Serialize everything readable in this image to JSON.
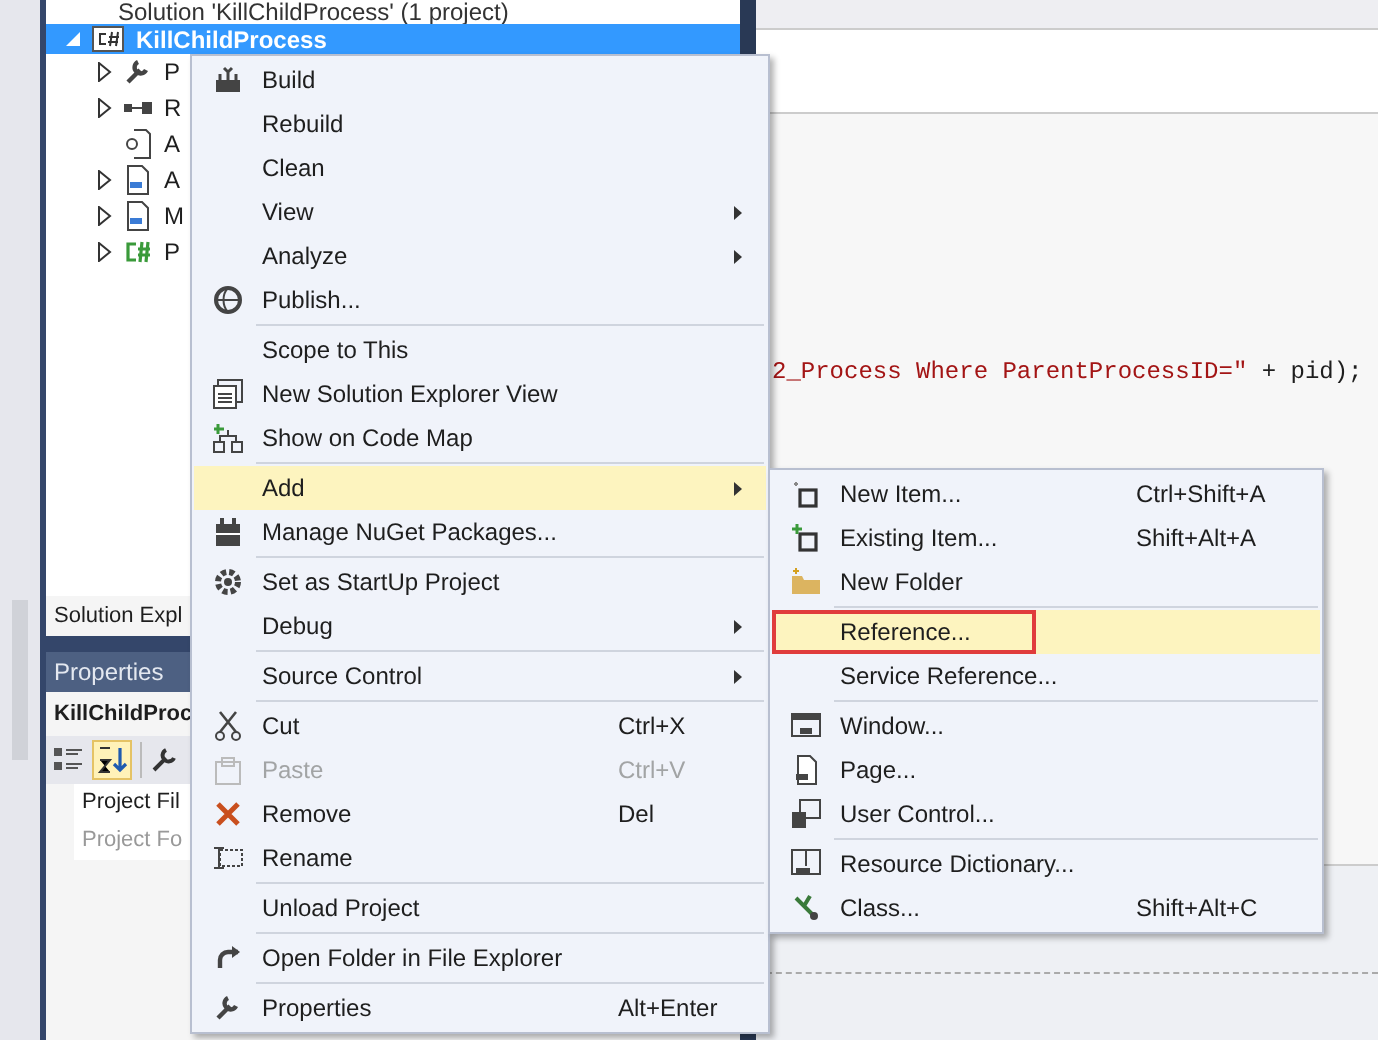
{
  "solution_explorer": {
    "solution_row": "Solution 'KillChildProcess' (1 project)",
    "project_row": {
      "label": "KillChildProcess",
      "selected": true
    },
    "children": [
      {
        "label": "P",
        "expandable": true
      },
      {
        "label": "R",
        "expandable": true
      },
      {
        "label": "A",
        "expandable": false
      },
      {
        "label": "A",
        "expandable": true
      },
      {
        "label": "M",
        "expandable": true
      },
      {
        "label": "P",
        "expandable": true
      }
    ],
    "tab": "Solution Expl"
  },
  "properties": {
    "title": "Properties",
    "object": "KillChildProc",
    "rows": [
      {
        "label": "Project Fil",
        "disabled": false
      },
      {
        "label": "Project Fo",
        "disabled": true
      }
    ]
  },
  "editor": {
    "code_string": "2_Process Where ParentProcessID=\"",
    "code_rest": " + pid);"
  },
  "context_menu": [
    {
      "kind": "item",
      "label": "Build",
      "submenu": false,
      "disabled": false,
      "selected": false
    },
    {
      "kind": "item",
      "label": "Rebuild",
      "submenu": false,
      "disabled": false,
      "selected": false
    },
    {
      "kind": "item",
      "label": "Clean",
      "submenu": false,
      "disabled": false,
      "selected": false
    },
    {
      "kind": "item",
      "label": "View",
      "submenu": true,
      "disabled": false,
      "selected": false
    },
    {
      "kind": "item",
      "label": "Analyze",
      "submenu": true,
      "disabled": false,
      "selected": false
    },
    {
      "kind": "item",
      "label": "Publish...",
      "submenu": false,
      "disabled": false,
      "selected": false
    },
    {
      "kind": "separator"
    },
    {
      "kind": "item",
      "label": "Scope to This",
      "submenu": false,
      "disabled": false,
      "selected": false
    },
    {
      "kind": "item",
      "label": "New Solution Explorer View",
      "submenu": false,
      "disabled": false,
      "selected": false
    },
    {
      "kind": "item",
      "label": "Show on Code Map",
      "submenu": false,
      "disabled": false,
      "selected": false
    },
    {
      "kind": "separator"
    },
    {
      "kind": "item",
      "label": "Add",
      "submenu": true,
      "disabled": false,
      "selected": true
    },
    {
      "kind": "item",
      "label": "Manage NuGet Packages...",
      "submenu": false,
      "disabled": false,
      "selected": false
    },
    {
      "kind": "separator"
    },
    {
      "kind": "item",
      "label": "Set as StartUp Project",
      "submenu": false,
      "disabled": false,
      "selected": false
    },
    {
      "kind": "item",
      "label": "Debug",
      "submenu": true,
      "disabled": false,
      "selected": false
    },
    {
      "kind": "separator"
    },
    {
      "kind": "item",
      "label": "Source Control",
      "submenu": true,
      "disabled": false,
      "selected": false
    },
    {
      "kind": "separator"
    },
    {
      "kind": "item",
      "label": "Cut",
      "shortcut": "Ctrl+X",
      "submenu": false,
      "disabled": false,
      "selected": false
    },
    {
      "kind": "item",
      "label": "Paste",
      "shortcut": "Ctrl+V",
      "submenu": false,
      "disabled": true,
      "selected": false
    },
    {
      "kind": "item",
      "label": "Remove",
      "shortcut": "Del",
      "submenu": false,
      "disabled": false,
      "selected": false
    },
    {
      "kind": "item",
      "label": "Rename",
      "submenu": false,
      "disabled": false,
      "selected": false
    },
    {
      "kind": "separator"
    },
    {
      "kind": "item",
      "label": "Unload Project",
      "submenu": false,
      "disabled": false,
      "selected": false
    },
    {
      "kind": "separator"
    },
    {
      "kind": "item",
      "label": "Open Folder in File Explorer",
      "submenu": false,
      "disabled": false,
      "selected": false
    },
    {
      "kind": "separator"
    },
    {
      "kind": "item",
      "label": "Properties",
      "shortcut": "Alt+Enter",
      "submenu": false,
      "disabled": false,
      "selected": false
    }
  ],
  "add_submenu": [
    {
      "kind": "item",
      "label": "New Item...",
      "shortcut": "Ctrl+Shift+A",
      "selected": false,
      "outlined": false
    },
    {
      "kind": "item",
      "label": "Existing Item...",
      "shortcut": "Shift+Alt+A",
      "selected": false,
      "outlined": false
    },
    {
      "kind": "item",
      "label": "New Folder",
      "selected": false,
      "outlined": false
    },
    {
      "kind": "separator"
    },
    {
      "kind": "item",
      "label": "Reference...",
      "selected": true,
      "outlined": true
    },
    {
      "kind": "item",
      "label": "Service Reference...",
      "selected": false,
      "outlined": false
    },
    {
      "kind": "separator"
    },
    {
      "kind": "item",
      "label": "Window...",
      "selected": false,
      "outlined": false
    },
    {
      "kind": "item",
      "label": "Page...",
      "selected": false,
      "outlined": false
    },
    {
      "kind": "item",
      "label": "User Control...",
      "selected": false,
      "outlined": false
    },
    {
      "kind": "separator"
    },
    {
      "kind": "item",
      "label": "Resource Dictionary...",
      "selected": false,
      "outlined": false
    },
    {
      "kind": "item",
      "label": "Class...",
      "shortcut": "Shift+Alt+C",
      "selected": false,
      "outlined": false
    }
  ]
}
